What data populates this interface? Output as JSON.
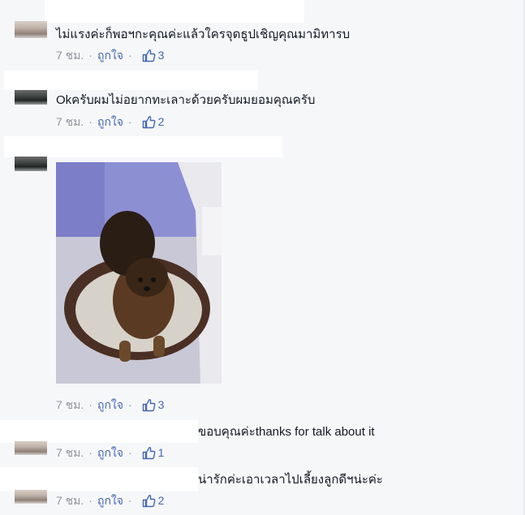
{
  "comments": [
    {
      "text": "ไม่แรงค่ะก็พอฯกะคุณค่ะแล้วใครจุดธูปเชิญคุณมามิทารบ",
      "time": "7 ชม.",
      "separator": "·",
      "like_label": "ถูกใจ",
      "like_count": "3"
    },
    {
      "text": "Okครับผมไม่อยากทะเลาะด้วยครับผมยอมคุณครับ",
      "time": "7 ชม.",
      "separator": "·",
      "like_label": "ถูกใจ",
      "like_count": "2"
    },
    {
      "text": "",
      "time": "7 ชม.",
      "separator": "·",
      "like_label": "ถูกใจ",
      "like_count": "3",
      "photo": "dog-in-round-pet-bed"
    },
    {
      "text": "ขอบคุณค่ะthanks for talk about it",
      "time": "7 ชม.",
      "separator": "·",
      "like_label": "ถูกใจ",
      "like_count": "1"
    },
    {
      "text": "น่ารักค่ะเอาเวลาไปเลี้ยงลูกดีฯน่ะค่ะ",
      "time": "7 ชม.",
      "separator": "·",
      "like_label": "ถูกใจ",
      "like_count": "2"
    }
  ],
  "icons": {
    "like": "thumbs-up-icon"
  },
  "colors": {
    "background": "#f6f7f9",
    "text": "#141823",
    "meta": "#90949c",
    "link": "#4267b2"
  }
}
